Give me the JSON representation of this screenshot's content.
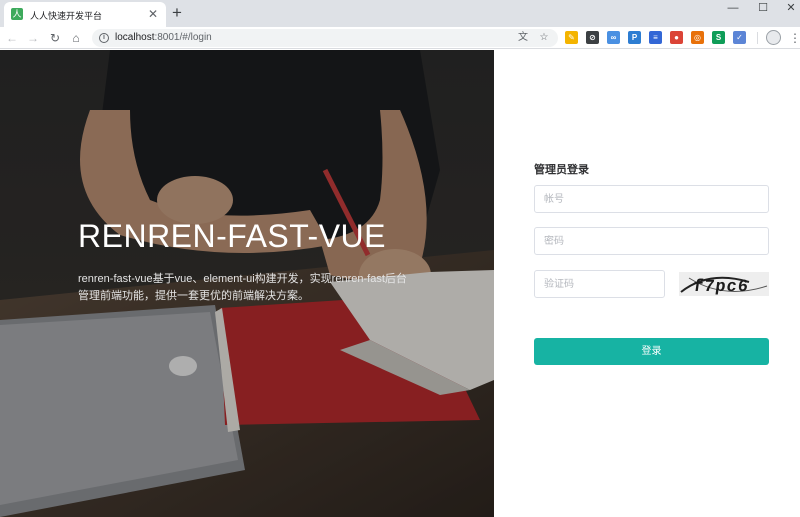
{
  "browser": {
    "tab": {
      "title": "人人快速开发平台",
      "favicon": "人"
    },
    "newtab_icon": "+",
    "window_controls": {
      "minimize": "—",
      "maximize": "☐",
      "close": "✕"
    },
    "nav": {
      "back": "←",
      "forward": "→",
      "reload": "↻",
      "home": "⌂"
    },
    "address": {
      "host": "localhost",
      "rest": ":8001/#/login",
      "info": "i"
    },
    "omnibox_icons": {
      "translate": "文",
      "bookmark": "☆"
    },
    "extensions": [
      {
        "name": "ext-1",
        "color": "#f4b400",
        "glyph": "✎"
      },
      {
        "name": "ext-2",
        "color": "#3c4043",
        "glyph": "⊘"
      },
      {
        "name": "ext-3",
        "color": "#4a90e2",
        "glyph": "∞"
      },
      {
        "name": "ext-4",
        "color": "#2d7dd2",
        "glyph": "P"
      },
      {
        "name": "ext-5",
        "color": "#3367d6",
        "glyph": "≡"
      },
      {
        "name": "ext-6",
        "color": "#db4437",
        "glyph": "●"
      },
      {
        "name": "ext-7",
        "color": "#e8710a",
        "glyph": "◎"
      },
      {
        "name": "ext-8",
        "color": "#0f9d58",
        "glyph": "S"
      },
      {
        "name": "ext-9",
        "color": "#5c85d6",
        "glyph": "✓"
      }
    ],
    "menu": "⋮"
  },
  "hero": {
    "title": "RENREN-FAST-VUE",
    "description": "renren-fast-vue基于vue、element-ui构建开发，实现renren-fast后台管理前端功能，提供一套更优的前端解决方案。"
  },
  "login": {
    "title": "管理员登录",
    "username_placeholder": "帐号",
    "password_placeholder": "密码",
    "captcha_placeholder": "验证码",
    "captcha_text": "f7pc6",
    "submit_label": "登录",
    "accent_color": "#17b3a3"
  }
}
